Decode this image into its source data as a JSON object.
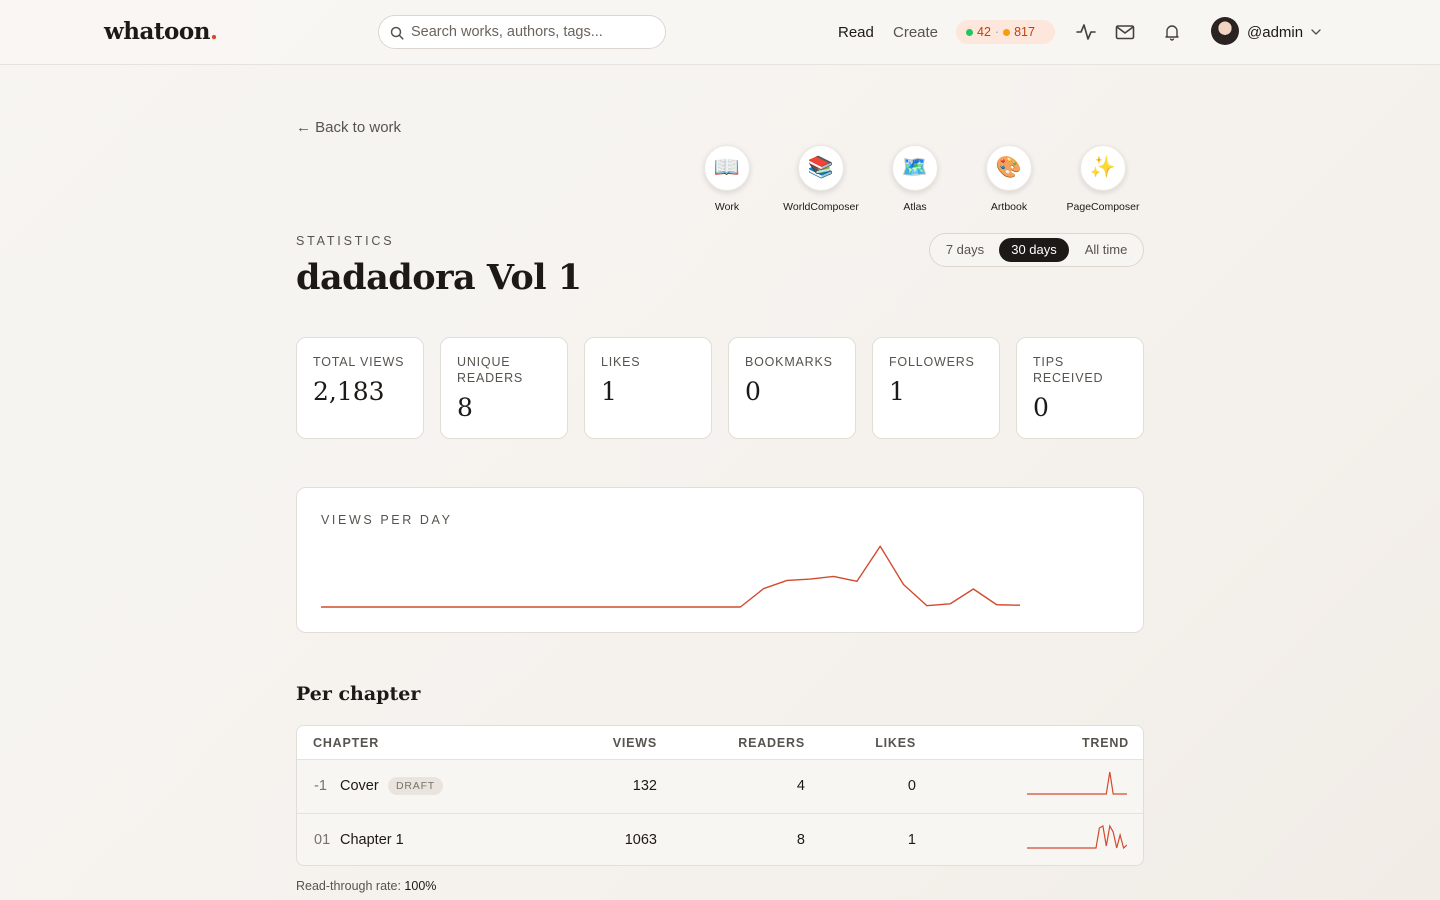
{
  "header": {
    "logo_text": "whatoon",
    "logo_dot": ".",
    "search_placeholder": "Search works, authors, tags...",
    "nav_read": "Read",
    "nav_create": "Create",
    "counter_green": "42",
    "counter_sep": "·",
    "counter_orange": "817",
    "activity_icon": "activity-icon",
    "mail_icon": "mail-icon",
    "bell_icon": "bell-icon",
    "username": "@admin"
  },
  "back_link": "← Back to work",
  "apps": [
    {
      "label": "Work",
      "glyph": "📖"
    },
    {
      "label": "WorldComposer",
      "glyph": "📚"
    },
    {
      "label": "Atlas",
      "glyph": "🗺️"
    },
    {
      "label": "Artbook",
      "glyph": "🎨"
    },
    {
      "label": "PageComposer",
      "glyph": "✨"
    }
  ],
  "eyebrow": "STATISTICS",
  "title": "dadadora Vol 1",
  "range": {
    "options": [
      "7 days",
      "30 days",
      "All time"
    ],
    "selected": "30 days"
  },
  "stats": [
    {
      "label": "TOTAL VIEWS",
      "value": "2,183"
    },
    {
      "label": "UNIQUE READERS",
      "value": "8"
    },
    {
      "label": "LIKES",
      "value": "1"
    },
    {
      "label": "BOOKMARKS",
      "value": "0"
    },
    {
      "label": "FOLLOWERS",
      "value": "1"
    },
    {
      "label": "TIPS RECEIVED",
      "value": "0"
    }
  ],
  "views_panel_title": "VIEWS PER DAY",
  "chart_data": {
    "type": "line",
    "title": "VIEWS PER DAY",
    "series": [
      {
        "values": [
          0,
          0,
          0,
          0,
          0,
          0,
          0,
          0,
          0,
          0,
          0,
          0,
          0,
          0,
          0,
          0,
          0,
          0,
          0,
          41,
          59,
          62,
          68,
          57,
          135,
          50,
          3,
          7,
          40,
          5,
          4
        ]
      }
    ],
    "ylim": [
      0,
      140
    ],
    "color": "#d24b2f",
    "grid": false
  },
  "per_chapter": {
    "title": "Per chapter",
    "columns": [
      "CHAPTER",
      "VIEWS",
      "READERS",
      "LIKES",
      "TREND"
    ],
    "rows": [
      {
        "num": "-1",
        "name": "Cover",
        "badge": "DRAFT",
        "views": "132",
        "readers": "4",
        "likes": "0",
        "trend": [
          0,
          0,
          0,
          0,
          0,
          0,
          0,
          0,
          0,
          0,
          0,
          0,
          0,
          0,
          0,
          0,
          0,
          0,
          0,
          0,
          0,
          0,
          0,
          0,
          22,
          0,
          0,
          0,
          0,
          0
        ]
      },
      {
        "num": "01",
        "name": "Chapter 1",
        "badge": "",
        "views": "1063",
        "readers": "8",
        "likes": "1",
        "trend": [
          0,
          0,
          0,
          0,
          0,
          0,
          0,
          0,
          0,
          0,
          0,
          0,
          0,
          0,
          0,
          0,
          0,
          0,
          0,
          0,
          0,
          20,
          22,
          2,
          22,
          16,
          0,
          13,
          0,
          3
        ]
      }
    ]
  },
  "footnote_label": "Read-through rate:",
  "footnote_value": "100%"
}
